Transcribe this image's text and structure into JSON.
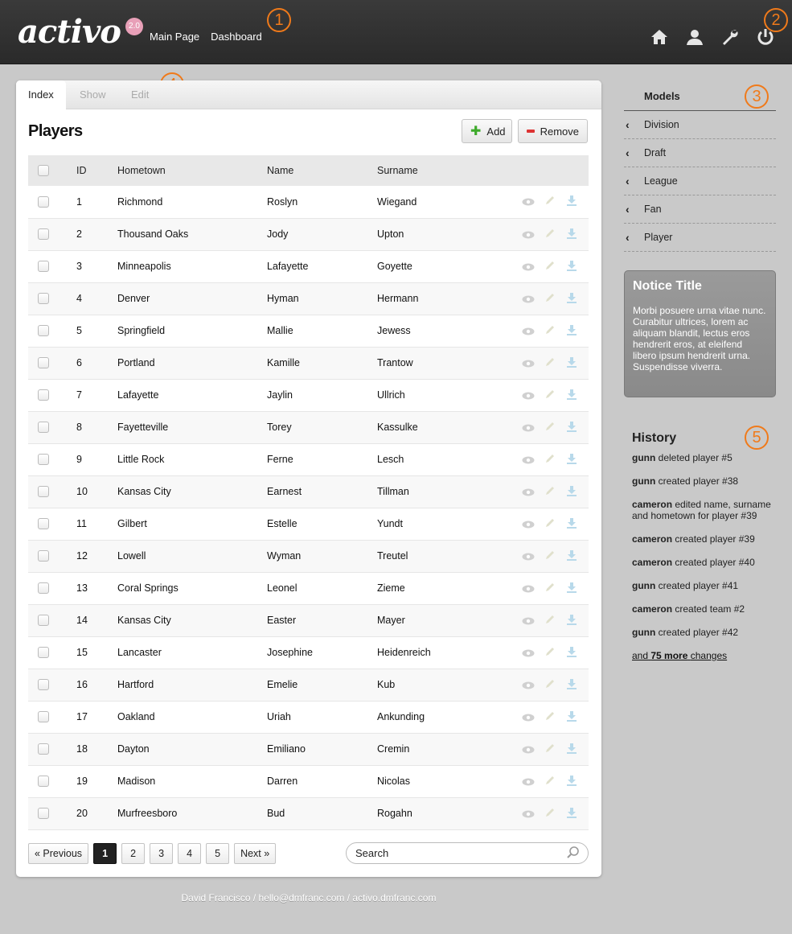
{
  "header": {
    "logo": "activo",
    "version_badge": "2.0",
    "nav": [
      "Main Page",
      "Dashboard"
    ],
    "icons": [
      "home-icon",
      "user-icon",
      "wrench-icon",
      "power-icon"
    ]
  },
  "markers": [
    "1",
    "2",
    "3",
    "4",
    "5"
  ],
  "tabs": [
    "Index",
    "Show",
    "Edit"
  ],
  "panel": {
    "title": "Players",
    "add_label": "Add",
    "remove_label": "Remove"
  },
  "table": {
    "columns": [
      "ID",
      "Hometown",
      "Name",
      "Surname"
    ],
    "rows": [
      [
        "1",
        "Richmond",
        "Roslyn",
        "Wiegand"
      ],
      [
        "2",
        "Thousand Oaks",
        "Jody",
        "Upton"
      ],
      [
        "3",
        "Minneapolis",
        "Lafayette",
        "Goyette"
      ],
      [
        "4",
        "Denver",
        "Hyman",
        "Hermann"
      ],
      [
        "5",
        "Springfield",
        "Mallie",
        "Jewess"
      ],
      [
        "6",
        "Portland",
        "Kamille",
        "Trantow"
      ],
      [
        "7",
        "Lafayette",
        "Jaylin",
        "Ullrich"
      ],
      [
        "8",
        "Fayetteville",
        "Torey",
        "Kassulke"
      ],
      [
        "9",
        "Little Rock",
        "Ferne",
        "Lesch"
      ],
      [
        "10",
        "Kansas City",
        "Earnest",
        "Tillman"
      ],
      [
        "11",
        "Gilbert",
        "Estelle",
        "Yundt"
      ],
      [
        "12",
        "Lowell",
        "Wyman",
        "Treutel"
      ],
      [
        "13",
        "Coral Springs",
        "Leonel",
        "Zieme"
      ],
      [
        "14",
        "Kansas City",
        "Easter",
        "Mayer"
      ],
      [
        "15",
        "Lancaster",
        "Josephine",
        "Heidenreich"
      ],
      [
        "16",
        "Hartford",
        "Emelie",
        "Kub"
      ],
      [
        "17",
        "Oakland",
        "Uriah",
        "Ankunding"
      ],
      [
        "18",
        "Dayton",
        "Emiliano",
        "Cremin"
      ],
      [
        "19",
        "Madison",
        "Darren",
        "Nicolas"
      ],
      [
        "20",
        "Murfreesboro",
        "Bud",
        "Rogahn"
      ]
    ]
  },
  "pagination": {
    "previous": "« Previous",
    "pages": [
      "1",
      "2",
      "3",
      "4",
      "5"
    ],
    "current": "1",
    "next": "Next »"
  },
  "search": {
    "placeholder": "Search"
  },
  "sidebar": {
    "models_title": "Models",
    "models": [
      "Division",
      "Draft",
      "League",
      "Fan",
      "Player"
    ],
    "notice_title": "Notice Title",
    "notice_text": "Morbi posuere urna vitae nunc. Curabitur ultrices, lorem ac aliquam blandit, lectus eros hendrerit eros, at eleifend libero ipsum hendrerit urna. Suspendisse viverra.",
    "history_title": "History",
    "history": [
      {
        "user": "gunn",
        "action": "deleted player #5"
      },
      {
        "user": "gunn",
        "action": "created player #38"
      },
      {
        "user": "cameron",
        "action": "edited name, surname and hometown for player #39"
      },
      {
        "user": "cameron",
        "action": "created player #39"
      },
      {
        "user": "cameron",
        "action": "created player #40"
      },
      {
        "user": "gunn",
        "action": "created player #41"
      },
      {
        "user": "cameron",
        "action": "created team #2"
      },
      {
        "user": "gunn",
        "action": "created player #42"
      }
    ],
    "more_prefix": "and",
    "more_count": "75 more",
    "more_suffix": "changes"
  },
  "footer": "David Francisco / hello@dmfranc.com / activo.dmfranc.com",
  "colors": {
    "accent_orange": "#f07a1a",
    "topbar": "#2f2f2f",
    "badge": "#e8a0b8"
  }
}
